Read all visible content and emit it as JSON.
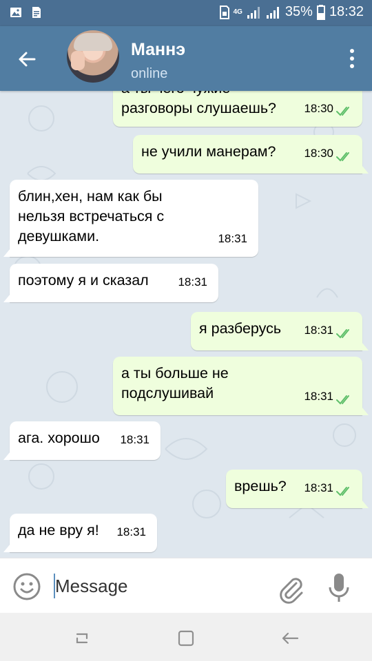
{
  "status_bar": {
    "network": "4G",
    "battery": "35%",
    "time": "18:32"
  },
  "header": {
    "contact_name": "Маннэ",
    "contact_status": "online"
  },
  "messages": [
    {
      "direction": "out",
      "text": "а ты чего чужие разговоры слушаешь?",
      "time": "18:30",
      "read": true
    },
    {
      "direction": "out",
      "text": "не учили манерам?",
      "time": "18:30",
      "read": true
    },
    {
      "direction": "in",
      "text": "блин,хен, нам как бы нельзя встречаться с девушками.",
      "time": "18:31"
    },
    {
      "direction": "in",
      "text": "поэтому я и сказал",
      "time": "18:31"
    },
    {
      "direction": "out",
      "text": "я разберусь",
      "time": "18:31",
      "read": true
    },
    {
      "direction": "out",
      "text": "а ты больше не подслушивай",
      "time": "18:31",
      "read": true
    },
    {
      "direction": "in",
      "text": "ага. хорошо",
      "time": "18:31"
    },
    {
      "direction": "out",
      "text": "врешь?",
      "time": "18:31",
      "read": true
    },
    {
      "direction": "in",
      "text": "да не вру я!",
      "time": "18:31"
    }
  ],
  "input": {
    "placeholder": "Message"
  },
  "colors": {
    "header": "#517da2",
    "status_bar": "#4a6f93",
    "outgoing_bubble": "#effedd",
    "incoming_bubble": "#ffffff",
    "check": "#5fbf6a"
  },
  "icons": {
    "back": "back-arrow-icon",
    "menu": "more-vertical-icon",
    "emoji": "emoji-icon",
    "attach": "paperclip-icon",
    "mic": "microphone-icon"
  }
}
